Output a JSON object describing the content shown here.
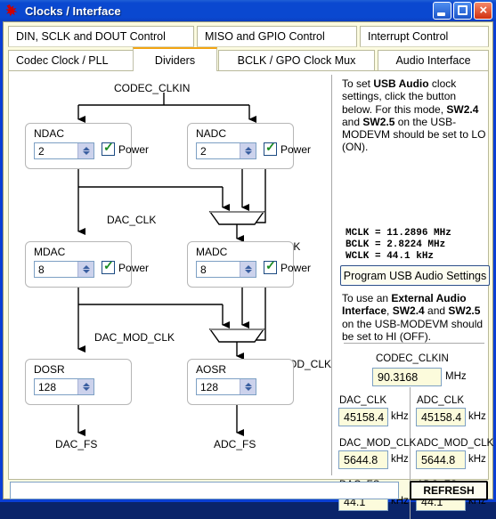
{
  "window": {
    "title": "Clocks / Interface",
    "app_icon": "ti-logo-icon",
    "buttons": {
      "minimize": "minimize-icon",
      "maximize": "maximize-icon",
      "close": "×"
    }
  },
  "tabs": {
    "row1": [
      {
        "label": "DIN, SCLK and DOUT Control",
        "active": false
      },
      {
        "label": "MISO and GPIO Control",
        "active": false
      },
      {
        "label": "Interrupt Control",
        "active": false
      }
    ],
    "row2": [
      {
        "label": "Codec Clock / PLL",
        "active": false
      },
      {
        "label": "Dividers",
        "active": true
      },
      {
        "label": "BCLK / GPO Clock Mux",
        "active": false
      },
      {
        "label": "Audio Interface",
        "active": false
      }
    ]
  },
  "diagram": {
    "source_label": "CODEC_CLKIN",
    "blocks": [
      {
        "title": "NDAC",
        "value": "2",
        "power_label": "Power",
        "power_checked": true
      },
      {
        "title": "NADC",
        "value": "2",
        "power_label": "Power",
        "power_checked": true
      },
      {
        "title": "MDAC",
        "value": "8",
        "power_label": "Power",
        "power_checked": true
      },
      {
        "title": "MADC",
        "value": "8",
        "power_label": "Power",
        "power_checked": true
      },
      {
        "title": "DOSR",
        "value": "128",
        "power_label": null,
        "power_checked": false
      },
      {
        "title": "AOSR",
        "value": "128",
        "power_label": null,
        "power_checked": false
      }
    ],
    "signals": {
      "dac_clk": "DAC_CLK",
      "adc_clk": "ADC_CLK",
      "dac_mod_clk": "DAC_MOD_CLK",
      "adc_mod_clk": "ADC_MOD_CLK",
      "dac_fs": "DAC_FS",
      "adc_fs": "ADC_FS"
    }
  },
  "right_panel": {
    "usb_note": {
      "line1_a": "To set ",
      "line1_b": "USB Audio",
      "line1_c": " clock settings, click the button below. For this mode, ",
      "line1_d": "SW2.4",
      "line1_e": " and ",
      "line1_f": "SW2.5",
      "line1_g": " on the USB-MODEVM should be set to LO (ON)."
    },
    "clock_block": "MCLK = 11.2896 MHz\nBCLK = 2.8224 MHz\nWCLK = 44.1 kHz",
    "program_button": "Program USB Audio Settings",
    "ext_note": {
      "a": "To use an ",
      "b": "External Audio Interface",
      "c": ", ",
      "d": "SW2.4",
      "e": " and ",
      "f": "SW2.5",
      "g": " on the USB-MODEVM should be set to HI (OFF)."
    },
    "readouts": {
      "codec_clkin": {
        "label": "CODEC_CLKIN",
        "value": "90.3168",
        "unit": "MHz"
      },
      "dac_clk": {
        "label": "DAC_CLK",
        "value": "45158.4",
        "unit": "kHz"
      },
      "adc_clk": {
        "label": "ADC_CLK",
        "value": "45158.4",
        "unit": "kHz"
      },
      "dac_mod_clk": {
        "label": "DAC_MOD_CLK",
        "value": "5644.8",
        "unit": "kHz"
      },
      "adc_mod_clk": {
        "label": "ADC_MOD_CLK",
        "value": "5644.8",
        "unit": "kHz"
      },
      "dac_fs": {
        "label": "DAC_FS",
        "value": "44.1",
        "unit": "kHz"
      },
      "adc_fs": {
        "label": "ADC_FS",
        "value": "44.1",
        "unit": "kHz"
      }
    }
  },
  "status_bar": {
    "message": "",
    "refresh_label": "REFRESH"
  }
}
